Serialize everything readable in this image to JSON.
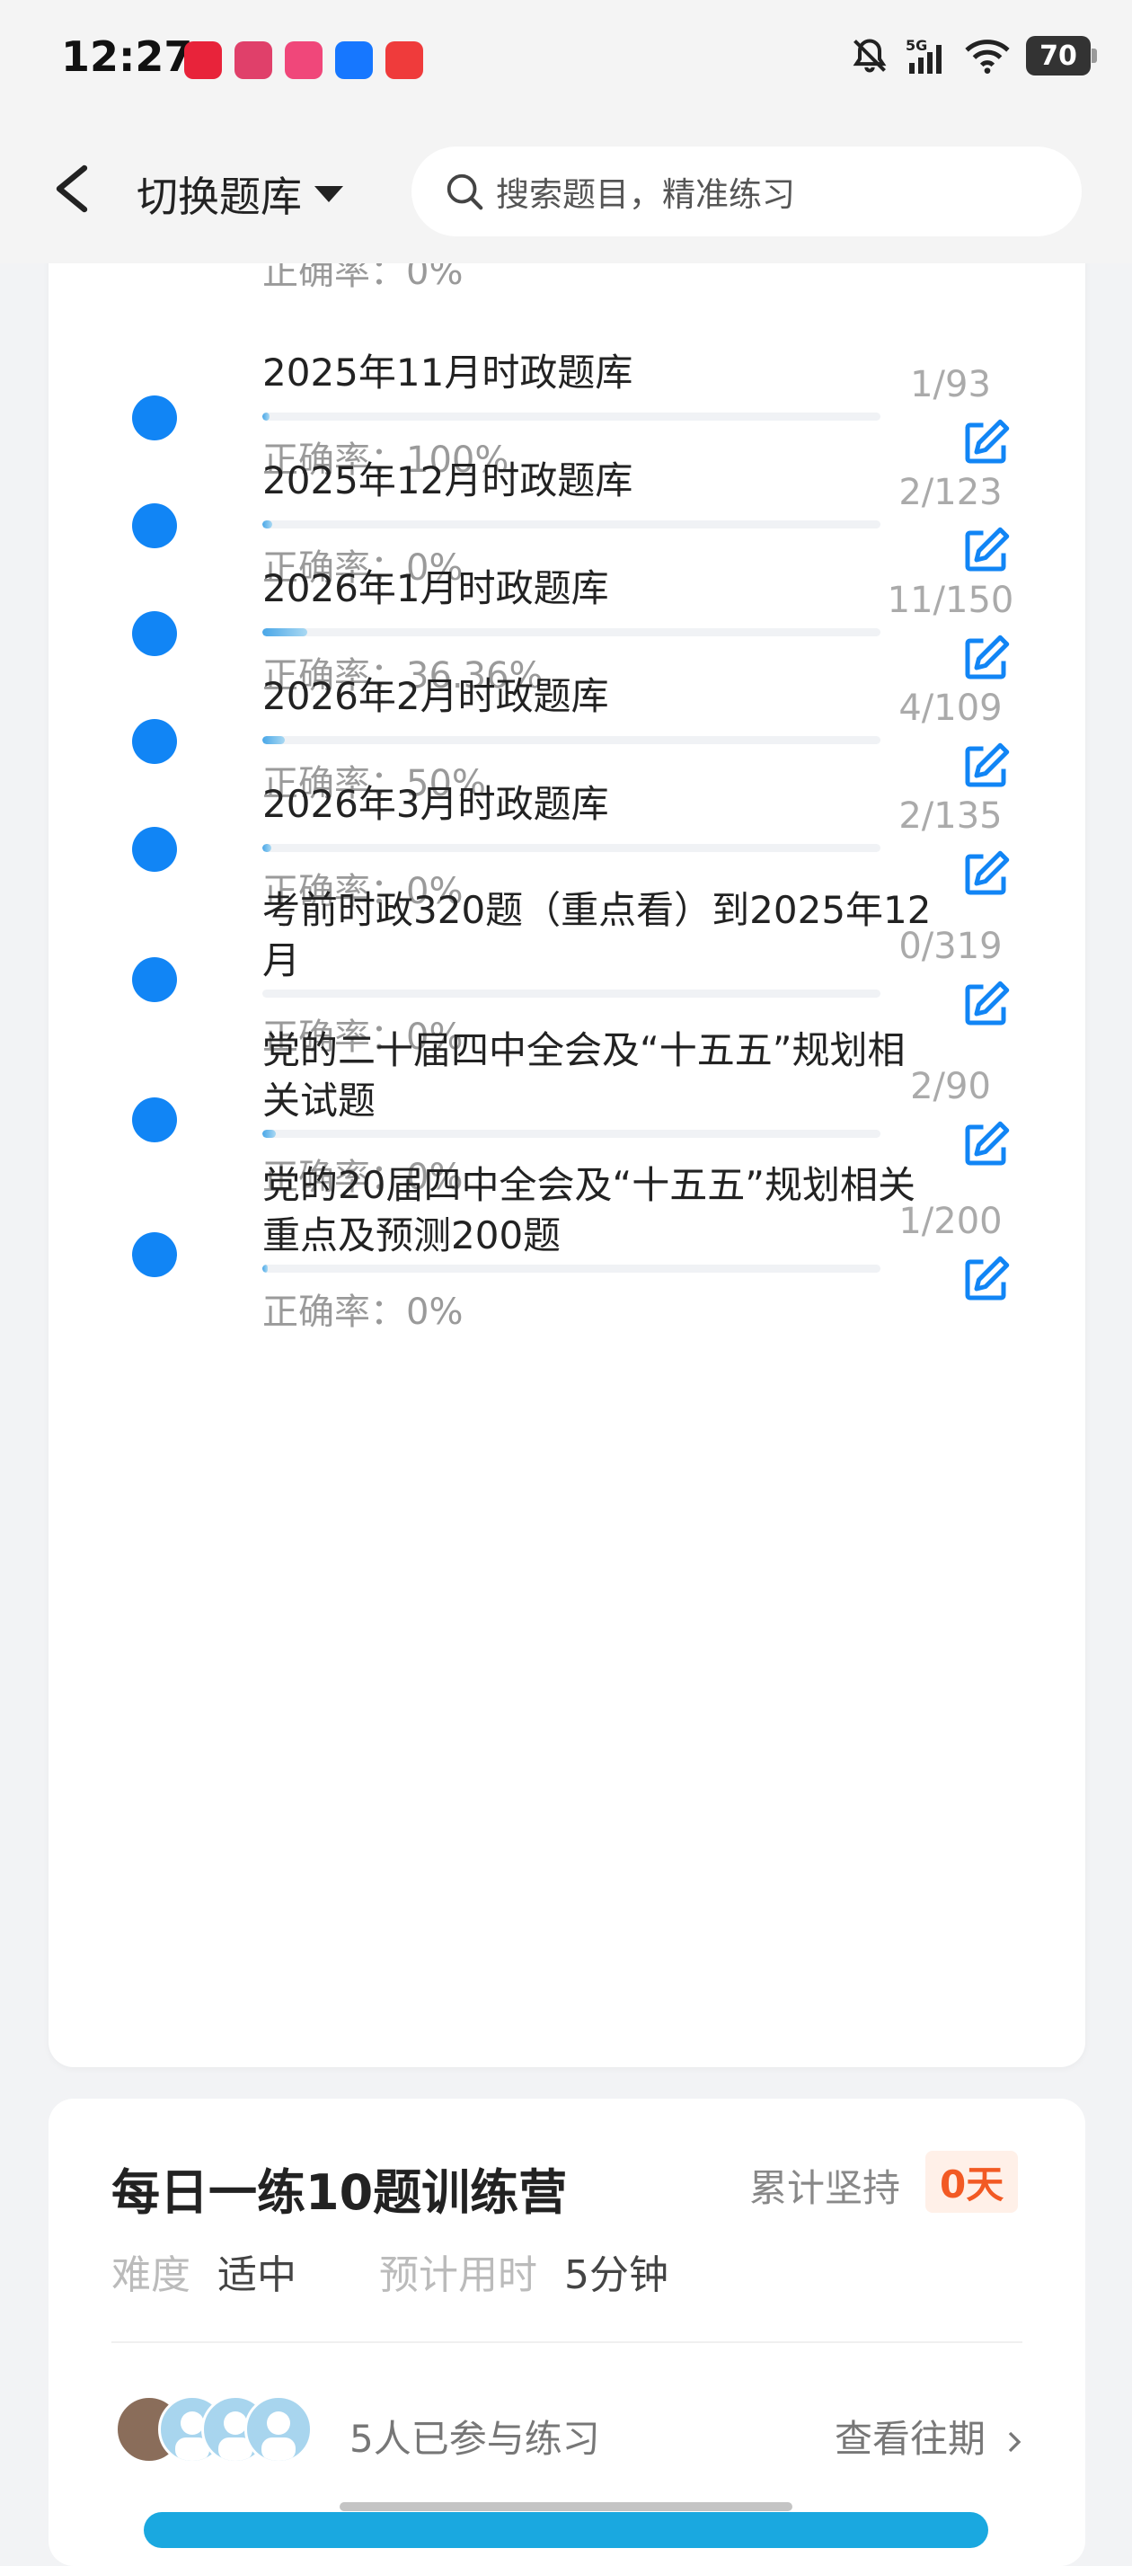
{
  "status_bar": {
    "time": "12:27",
    "battery": "70",
    "network": "5G",
    "notification_colors": [
      "#e8233a",
      "#e0406a",
      "#f0477a",
      "#1677ff",
      "#ef3b3b"
    ]
  },
  "header": {
    "switch_label": "切换题库",
    "search_placeholder": "搜索题目，精准练习"
  },
  "list": {
    "items": [
      {
        "title": "2025年11月时政题库",
        "done": 1,
        "total": 93,
        "count": "1/93",
        "accuracy": "正确率：100%",
        "progress": 0.011
      },
      {
        "title": "2025年12月时政题库",
        "done": 2,
        "total": 123,
        "count": "2/123",
        "accuracy": "正确率：0%",
        "progress": 0.016
      },
      {
        "title": "2026年1月时政题库",
        "done": 11,
        "total": 150,
        "count": "11/150",
        "accuracy": "正确率：36.36%",
        "progress": 0.073
      },
      {
        "title": "2026年2月时政题库",
        "done": 4,
        "total": 109,
        "count": "4/109",
        "accuracy": "正确率：50%",
        "progress": 0.037
      },
      {
        "title": "2026年3月时政题库",
        "done": 2,
        "total": 135,
        "count": "2/135",
        "accuracy": "正确率：0%",
        "progress": 0.015
      },
      {
        "title": "考前时政320题（重点看）到2025年12月",
        "done": 0,
        "total": 319,
        "count": "0/319",
        "accuracy": "正确率：0%",
        "progress": 0
      },
      {
        "title": "党的二十届四中全会及“十五五”规划相关试题",
        "done": 2,
        "total": 90,
        "count": "2/90",
        "accuracy": "正确率：0%",
        "progress": 0.022
      },
      {
        "title": "党的20届四中全会及“十五五”规划相关重点及预测200题",
        "done": 1,
        "total": 200,
        "count": "1/200",
        "accuracy": "正确率：0%",
        "progress": 0.005
      }
    ],
    "partial_top_accuracy": "正确率：0%"
  },
  "camp": {
    "title": "每日一练10题训练营",
    "persist_label": "累计坚持",
    "days": "0天",
    "difficulty_label": "难度",
    "difficulty_value": "适中",
    "time_label": "预计用时",
    "time_value": "5分钟",
    "joined": "5人已参与练习",
    "history": "查看往期"
  },
  "colors": {
    "accent": "#1185f5",
    "orange": "#f25a24"
  }
}
